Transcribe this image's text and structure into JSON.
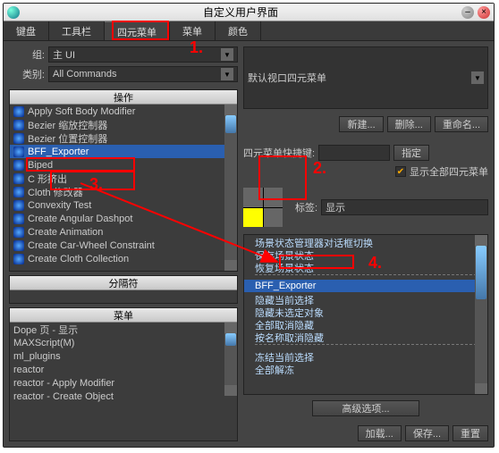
{
  "window": {
    "title": "自定义用户界面"
  },
  "tabs": [
    "键盘",
    "工具栏",
    "四元菜单",
    "菜单",
    "颜色"
  ],
  "active_tab": "四元菜单",
  "left": {
    "group_label": "组:",
    "group_value": "主 UI",
    "category_label": "类别:",
    "category_value": "All Commands",
    "ops_title": "操作",
    "ops": [
      "Apply Soft Body Modifier",
      "Bezier 缩放控制器",
      "Bezier 位置控制器",
      "BFF_Exporter",
      "Biped",
      "C 形挤出",
      "Cloth 修改器",
      "Convexity Test",
      "Create Angular Dashpot",
      "Create Animation",
      "Create Car-Wheel Constraint",
      "Create Cloth Collection"
    ],
    "ops_selected": 3,
    "sep_title": "分隔符",
    "menus_title": "菜单",
    "menus": [
      "Dope 页 - 显示",
      "MAXScript(M)",
      "ml_plugins",
      "reactor",
      "reactor - Apply Modifier",
      "reactor - Create Object"
    ]
  },
  "right": {
    "quad_dropdown": "默认视口四元菜单",
    "new_btn": "新建...",
    "delete_btn": "删除...",
    "rename_btn": "重命名...",
    "hotkey_label": "四元菜单快捷键:",
    "hotkey_value": "",
    "assign_btn": "指定",
    "show_all_label": "显示全部四元菜单",
    "show_all_checked": true,
    "tag_label": "标签:",
    "tag_value": "显示",
    "items": [
      "场景状态管理器对话框切换",
      "保存场景状态",
      "恢复场景状态",
      "",
      "BFF_Exporter",
      "隐藏当前选择",
      "隐藏未选定对象",
      "全部取消隐藏",
      "按名称取消隐藏",
      "",
      "冻结当前选择",
      "全部解冻"
    ],
    "items_selected": 4,
    "advanced_btn": "高级选项...",
    "load_btn": "加载...",
    "save_btn": "保存...",
    "reset_btn": "重置"
  },
  "annotations": {
    "a1": "1.",
    "a2": "2.",
    "a3": "3.",
    "a4": "4."
  }
}
